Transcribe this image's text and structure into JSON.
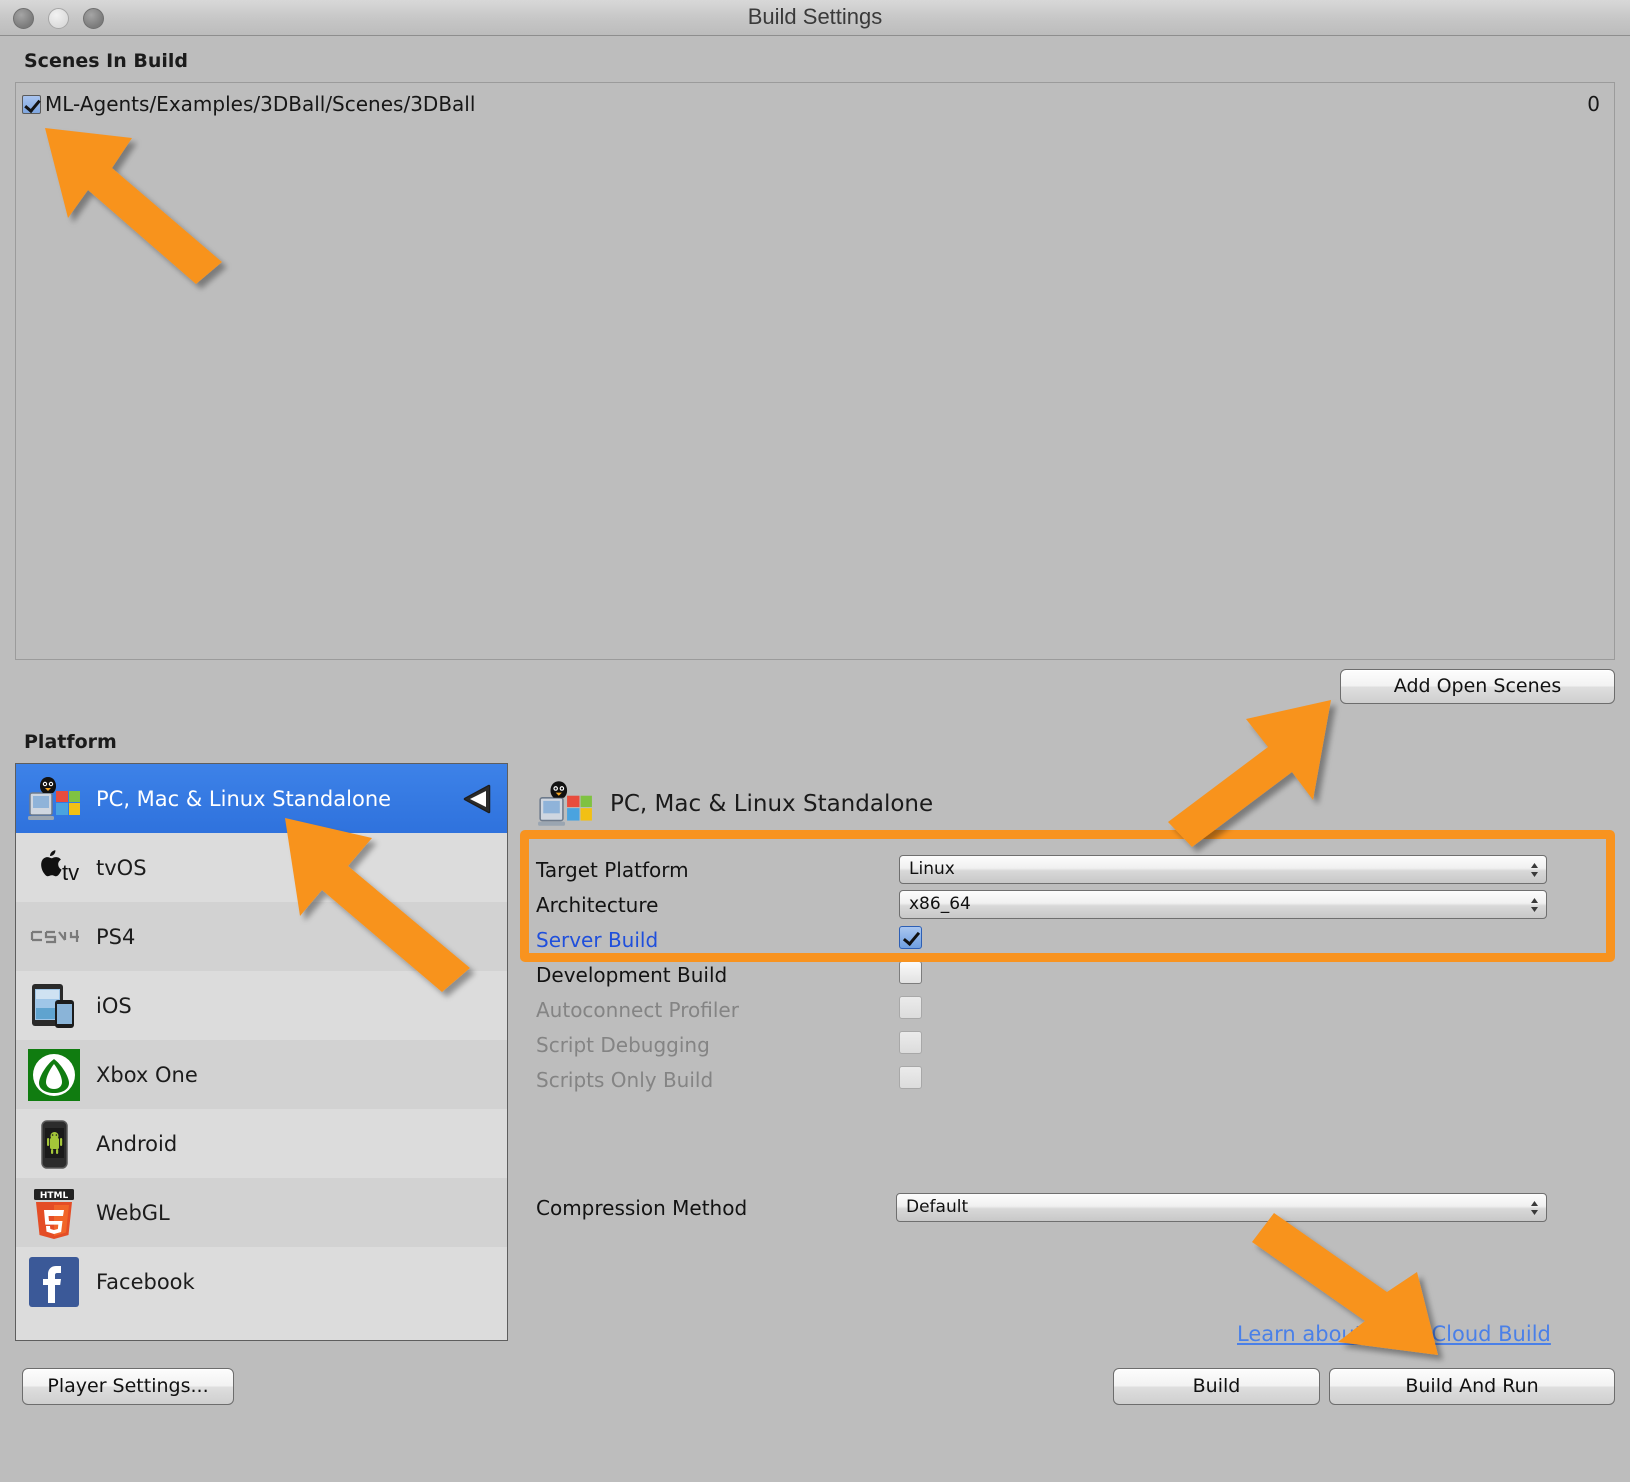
{
  "window": {
    "title": "Build Settings",
    "traffic_lights": [
      "close",
      "minimize",
      "maximize"
    ]
  },
  "scenes_section": {
    "label": "Scenes In Build",
    "scenes": [
      {
        "name": "ML-Agents/Examples/3DBall/Scenes/3DBall",
        "index": "0",
        "enabled": true
      }
    ],
    "add_open_scenes_label": "Add Open Scenes"
  },
  "platform_section": {
    "label": "Platform",
    "items": [
      {
        "name": "PC, Mac & Linux Standalone",
        "icon": "standalone-icon",
        "selected": true
      },
      {
        "name": "tvOS",
        "icon": "tvos-icon",
        "selected": false
      },
      {
        "name": "PS4",
        "icon": "ps4-icon",
        "selected": false
      },
      {
        "name": "iOS",
        "icon": "ios-icon",
        "selected": false
      },
      {
        "name": "Xbox One",
        "icon": "xboxone-icon",
        "selected": false
      },
      {
        "name": "Android",
        "icon": "android-icon",
        "selected": false
      },
      {
        "name": "WebGL",
        "icon": "webgl-icon",
        "selected": false
      },
      {
        "name": "Facebook",
        "icon": "facebook-icon",
        "selected": false
      }
    ],
    "player_settings_label": "Player Settings..."
  },
  "settings_pane": {
    "header_title": "PC, Mac & Linux Standalone",
    "target_platform": {
      "label": "Target Platform",
      "value": "Linux"
    },
    "architecture": {
      "label": "Architecture",
      "value": "x86_64"
    },
    "server_build": {
      "label": "Server Build",
      "checked": true
    },
    "development_build": {
      "label": "Development Build",
      "checked": false
    },
    "autoconnect_profiler": {
      "label": "Autoconnect Profiler",
      "checked": false
    },
    "script_debugging": {
      "label": "Script Debugging",
      "checked": false
    },
    "scripts_only_build": {
      "label": "Scripts Only Build",
      "checked": false
    },
    "compression_method": {
      "label": "Compression Method",
      "value": "Default"
    }
  },
  "footer": {
    "cloud_link": "Learn about Unity Cloud Build",
    "build_label": "Build",
    "build_and_run_label": "Build And Run"
  },
  "annotations": {
    "color": "#f8931f",
    "arrows": [
      "points-to-scene-checkbox",
      "points-to-add-open-scenes",
      "points-to-selected-platform",
      "points-to-build-and-run"
    ],
    "highlight_box": "server-build-settings-group"
  }
}
